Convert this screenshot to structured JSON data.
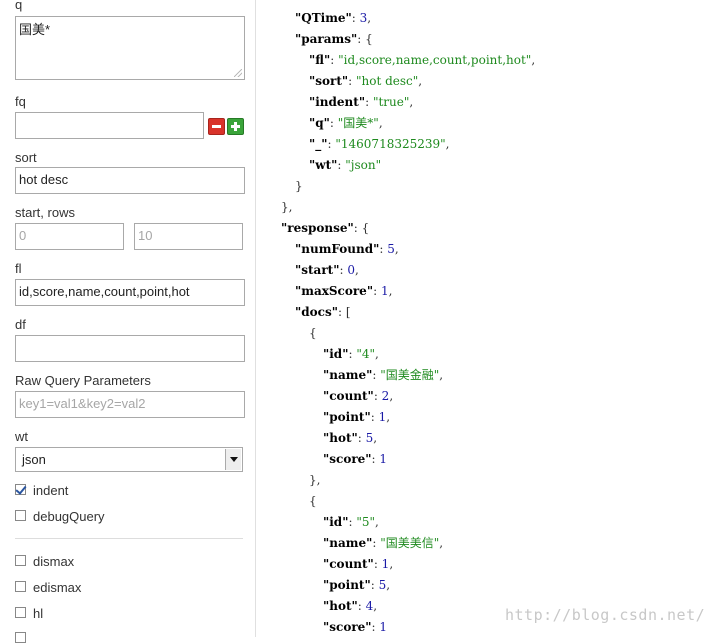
{
  "form": {
    "q": {
      "label": "q",
      "value": "国美*"
    },
    "fq": {
      "label": "fq",
      "value": ""
    },
    "sort": {
      "label": "sort",
      "value": "hot desc"
    },
    "start_rows": {
      "label": "start, rows",
      "start_placeholder": "0",
      "rows_placeholder": "10"
    },
    "fl": {
      "label": "fl",
      "value": "id,score,name,count,point,hot"
    },
    "df": {
      "label": "df",
      "value": ""
    },
    "raw": {
      "label": "Raw Query Parameters",
      "placeholder": "key1=val1&key2=val2"
    },
    "wt": {
      "label": "wt",
      "value": "json"
    },
    "indent": {
      "label": "indent",
      "checked": true
    },
    "debugQuery": {
      "label": "debugQuery",
      "checked": false
    },
    "dismax": {
      "label": "dismax"
    },
    "edismax": {
      "label": "edismax"
    },
    "hl": {
      "label": "hl"
    }
  },
  "json_lines": [
    {
      "indent": 1,
      "parts": [
        [
          "k",
          "\"QTime\""
        ],
        [
          "p",
          ": "
        ],
        [
          "n",
          "3"
        ],
        [
          "p",
          ","
        ]
      ]
    },
    {
      "indent": 1,
      "parts": [
        [
          "k",
          "\"params\""
        ],
        [
          "p",
          ": {"
        ]
      ]
    },
    {
      "indent": 2,
      "parts": [
        [
          "k",
          "\"fl\""
        ],
        [
          "p",
          ": "
        ],
        [
          "s",
          "\"id,score,name,count,point,hot\""
        ],
        [
          "p",
          ","
        ]
      ]
    },
    {
      "indent": 2,
      "parts": [
        [
          "k",
          "\"sort\""
        ],
        [
          "p",
          ": "
        ],
        [
          "s",
          "\"hot desc\""
        ],
        [
          "p",
          ","
        ]
      ]
    },
    {
      "indent": 2,
      "parts": [
        [
          "k",
          "\"indent\""
        ],
        [
          "p",
          ": "
        ],
        [
          "s",
          "\"true\""
        ],
        [
          "p",
          ","
        ]
      ]
    },
    {
      "indent": 2,
      "parts": [
        [
          "k",
          "\"q\""
        ],
        [
          "p",
          ": "
        ],
        [
          "s",
          "\"国美*\""
        ],
        [
          "p",
          ","
        ]
      ]
    },
    {
      "indent": 2,
      "parts": [
        [
          "k",
          "\"_\""
        ],
        [
          "p",
          ": "
        ],
        [
          "s",
          "\"1460718325239\""
        ],
        [
          "p",
          ","
        ]
      ]
    },
    {
      "indent": 2,
      "parts": [
        [
          "k",
          "\"wt\""
        ],
        [
          "p",
          ": "
        ],
        [
          "s",
          "\"json\""
        ]
      ]
    },
    {
      "indent": 1,
      "parts": [
        [
          "p",
          "}"
        ]
      ]
    },
    {
      "indent": 0,
      "parts": [
        [
          "p",
          "},"
        ]
      ]
    },
    {
      "indent": 0,
      "parts": [
        [
          "k",
          "\"response\""
        ],
        [
          "p",
          ": {"
        ]
      ]
    },
    {
      "indent": 1,
      "parts": [
        [
          "k",
          "\"numFound\""
        ],
        [
          "p",
          ": "
        ],
        [
          "n",
          "5"
        ],
        [
          "p",
          ","
        ]
      ]
    },
    {
      "indent": 1,
      "parts": [
        [
          "k",
          "\"start\""
        ],
        [
          "p",
          ": "
        ],
        [
          "n",
          "0"
        ],
        [
          "p",
          ","
        ]
      ]
    },
    {
      "indent": 1,
      "parts": [
        [
          "k",
          "\"maxScore\""
        ],
        [
          "p",
          ": "
        ],
        [
          "n",
          "1"
        ],
        [
          "p",
          ","
        ]
      ]
    },
    {
      "indent": 1,
      "parts": [
        [
          "k",
          "\"docs\""
        ],
        [
          "p",
          ": ["
        ]
      ]
    },
    {
      "indent": 2,
      "parts": [
        [
          "p",
          "{"
        ]
      ]
    },
    {
      "indent": 3,
      "parts": [
        [
          "k",
          "\"id\""
        ],
        [
          "p",
          ": "
        ],
        [
          "s",
          "\"4\""
        ],
        [
          "p",
          ","
        ]
      ]
    },
    {
      "indent": 3,
      "parts": [
        [
          "k",
          "\"name\""
        ],
        [
          "p",
          ": "
        ],
        [
          "s",
          "\"国美金融\""
        ],
        [
          "p",
          ","
        ]
      ]
    },
    {
      "indent": 3,
      "parts": [
        [
          "k",
          "\"count\""
        ],
        [
          "p",
          ": "
        ],
        [
          "n",
          "2"
        ],
        [
          "p",
          ","
        ]
      ]
    },
    {
      "indent": 3,
      "parts": [
        [
          "k",
          "\"point\""
        ],
        [
          "p",
          ": "
        ],
        [
          "n",
          "1"
        ],
        [
          "p",
          ","
        ]
      ]
    },
    {
      "indent": 3,
      "parts": [
        [
          "k",
          "\"hot\""
        ],
        [
          "p",
          ": "
        ],
        [
          "n",
          "5"
        ],
        [
          "p",
          ","
        ]
      ]
    },
    {
      "indent": 3,
      "parts": [
        [
          "k",
          "\"score\""
        ],
        [
          "p",
          ": "
        ],
        [
          "n",
          "1"
        ]
      ]
    },
    {
      "indent": 2,
      "parts": [
        [
          "p",
          "},"
        ]
      ]
    },
    {
      "indent": 2,
      "parts": [
        [
          "p",
          "{"
        ]
      ]
    },
    {
      "indent": 3,
      "parts": [
        [
          "k",
          "\"id\""
        ],
        [
          "p",
          ": "
        ],
        [
          "s",
          "\"5\""
        ],
        [
          "p",
          ","
        ]
      ]
    },
    {
      "indent": 3,
      "parts": [
        [
          "k",
          "\"name\""
        ],
        [
          "p",
          ": "
        ],
        [
          "s",
          "\"国美美信\""
        ],
        [
          "p",
          ","
        ]
      ]
    },
    {
      "indent": 3,
      "parts": [
        [
          "k",
          "\"count\""
        ],
        [
          "p",
          ": "
        ],
        [
          "n",
          "1"
        ],
        [
          "p",
          ","
        ]
      ]
    },
    {
      "indent": 3,
      "parts": [
        [
          "k",
          "\"point\""
        ],
        [
          "p",
          ": "
        ],
        [
          "n",
          "5"
        ],
        [
          "p",
          ","
        ]
      ]
    },
    {
      "indent": 3,
      "parts": [
        [
          "k",
          "\"hot\""
        ],
        [
          "p",
          ": "
        ],
        [
          "n",
          "4"
        ],
        [
          "p",
          ","
        ]
      ]
    },
    {
      "indent": 3,
      "parts": [
        [
          "k",
          "\"score\""
        ],
        [
          "p",
          ": "
        ],
        [
          "n",
          "1"
        ]
      ]
    }
  ],
  "watermark": "http://blog.csdn.net/",
  "colors": {
    "key": "#000000",
    "number": "#1a1aa6",
    "string": "#1e8a1e"
  }
}
